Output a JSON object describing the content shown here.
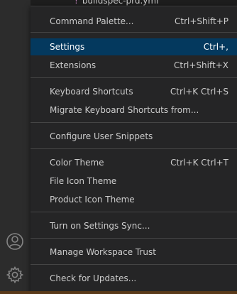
{
  "editor": {
    "file_name": "buildspec-prd.yml"
  },
  "activity_bar": {
    "accounts_icon": "account-icon",
    "manage_icon": "gear-icon"
  },
  "menu": {
    "items": [
      {
        "label": "Command Palette...",
        "keys": "Ctrl+Shift+P"
      },
      {
        "label": "Settings",
        "keys": "Ctrl+,",
        "active": true
      },
      {
        "label": "Extensions",
        "keys": "Ctrl+Shift+X"
      },
      {
        "label": "Keyboard Shortcuts",
        "keys": "Ctrl+K Ctrl+S"
      },
      {
        "label": "Migrate Keyboard Shortcuts from...",
        "keys": ""
      },
      {
        "label": "Configure User Snippets",
        "keys": ""
      },
      {
        "label": "Color Theme",
        "keys": "Ctrl+K Ctrl+T"
      },
      {
        "label": "File Icon Theme",
        "keys": ""
      },
      {
        "label": "Product Icon Theme",
        "keys": ""
      },
      {
        "label": "Turn on Settings Sync...",
        "keys": ""
      },
      {
        "label": "Manage Workspace Trust",
        "keys": ""
      },
      {
        "label": "Check for Updates...",
        "keys": ""
      }
    ]
  },
  "colors": {
    "menu_bg": "#252526",
    "highlight": "#04395e",
    "text": "#cccccc"
  }
}
